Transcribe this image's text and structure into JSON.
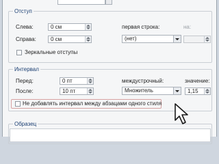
{
  "indent": {
    "title": "Отступ",
    "left_label": "Слева:",
    "left_value": "0 см",
    "right_label": "Справа:",
    "right_value": "0 см",
    "first_line_label": "первая строка:",
    "first_line_value": "(нет)",
    "on_label": "на:",
    "on_value": "",
    "mirror_label": "Зеркальные отступы"
  },
  "spacing": {
    "title": "Интервал",
    "before_label": "Перед:",
    "before_value": "0 пт",
    "after_label": "После:",
    "after_value": "10 пт",
    "line_spacing_label": "междустрочный:",
    "line_spacing_value": "Множитель",
    "value_label": "значение:",
    "value_value": "1,15",
    "no_space_label": "Не добавлять интервал между абзацами одного стиля"
  },
  "preview": {
    "title": "Образец"
  },
  "colors": {
    "group_title": "#1a3e72",
    "highlight": "#d7a2a2"
  }
}
